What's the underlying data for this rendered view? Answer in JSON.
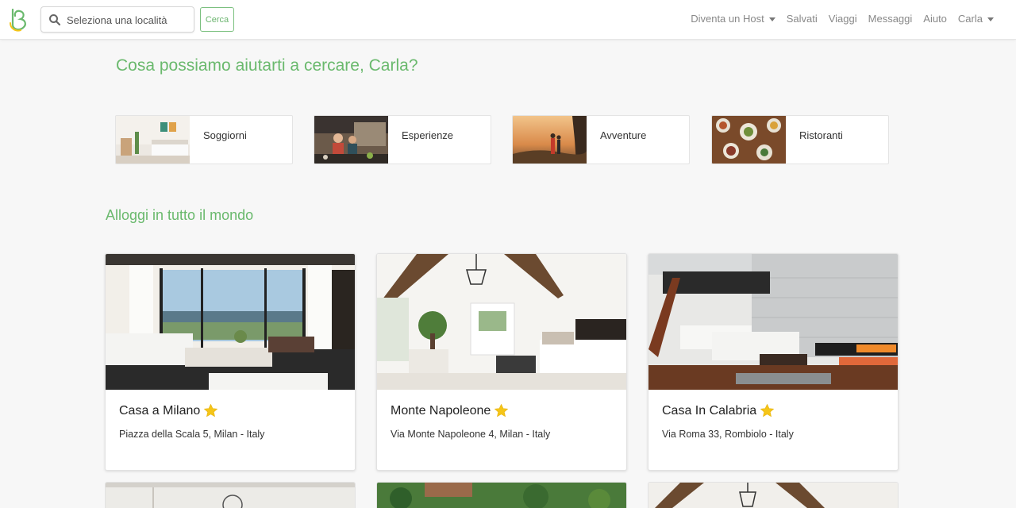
{
  "navbar": {
    "search": {
      "placeholder": "Seleziona una località",
      "icon": "search-icon"
    },
    "search_button": "Cerca",
    "links": [
      {
        "label": "Diventa un Host",
        "dropdown": true
      },
      {
        "label": "Salvati",
        "dropdown": false
      },
      {
        "label": "Viaggi",
        "dropdown": false
      },
      {
        "label": "Messaggi",
        "dropdown": false
      },
      {
        "label": "Aiuto",
        "dropdown": false
      },
      {
        "label": "Carla",
        "dropdown": true
      }
    ]
  },
  "greeting": "Cosa possiamo aiutarti a cercare, Carla?",
  "categories": [
    {
      "label": "Soggiorni"
    },
    {
      "label": "Esperienze"
    },
    {
      "label": "Avventure"
    },
    {
      "label": "Ristoranti"
    }
  ],
  "section_title": "Alloggi in tutto il mondo",
  "listings": [
    {
      "name": "Casa a Milano",
      "address": "Piazza della Scala 5, Milan - Italy",
      "featured": true
    },
    {
      "name": "Monte Napoleone",
      "address": "Via Monte Napoleone 4, Milan - Italy",
      "featured": true
    },
    {
      "name": "Casa In Calabria",
      "address": "Via Roma 33, Rombiolo - Italy",
      "featured": true
    }
  ],
  "colors": {
    "accent": "#6ab96d",
    "star": "#f5c518"
  }
}
